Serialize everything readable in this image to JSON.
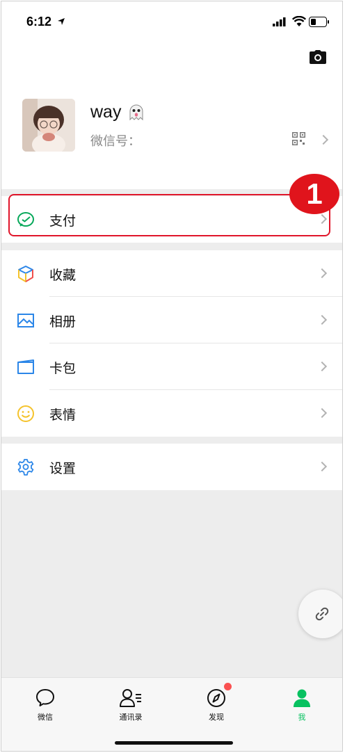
{
  "status_bar": {
    "time": "6:12"
  },
  "profile": {
    "nickname": "way",
    "wechat_id_label": "微信号："
  },
  "menu": {
    "pay": "支付",
    "favorites": "收藏",
    "album": "相册",
    "cards": "卡包",
    "stickers": "表情",
    "settings": "设置"
  },
  "annotation": {
    "step_number": "1"
  },
  "tabbar": {
    "tabs": [
      {
        "label": "微信",
        "icon": "chat-icon"
      },
      {
        "label": "通讯录",
        "icon": "contacts-icon"
      },
      {
        "label": "发现",
        "icon": "compass-icon"
      },
      {
        "label": "我",
        "icon": "person-icon"
      }
    ],
    "active": "我"
  },
  "colors": {
    "accent": "#07c160",
    "highlight": "#e0152a",
    "badge": "#fa5151"
  }
}
